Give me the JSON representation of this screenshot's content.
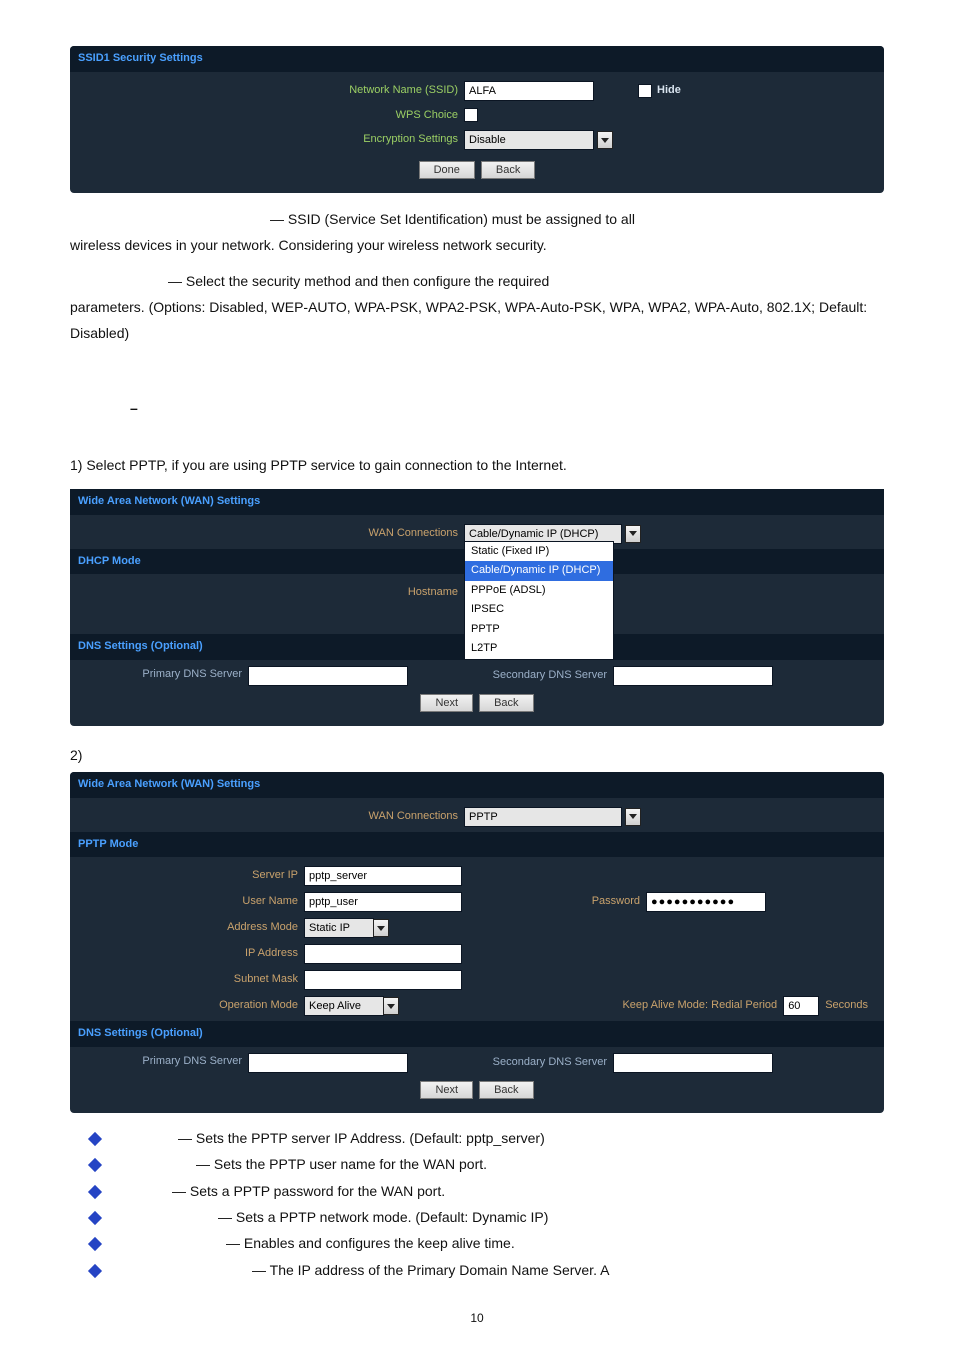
{
  "ssid_panel": {
    "title": "SSID1 Security Settings",
    "rows": {
      "network_name_label": "Network Name (SSID)",
      "network_name_value": "ALFA",
      "hide_label": "Hide",
      "wps_label": "WPS Choice",
      "encryption_label": "Encryption Settings",
      "encryption_value": "Disable"
    },
    "buttons": {
      "done": "Done",
      "back": "Back"
    }
  },
  "para1_a": "— SSID (Service Set Identification) must be assigned to all",
  "para1_b": "wireless devices in your network. Considering your wireless network security.",
  "para2_a": "— Select the security method and then configure the required",
  "para2_b": "parameters. (Options: Disabled, WEP-AUTO, WPA-PSK, WPA2-PSK, WPA-Auto-PSK, WPA, WPA2, WPA-Auto, 802.1X; Default: Disabled)",
  "dash": "–",
  "step1": "1)  Select PPTP, if you are using PPTP service to gain connection to the Internet.",
  "wan_panel": {
    "title": "Wide Area Network (WAN) Settings",
    "wan_conn_label": "WAN Connections",
    "wan_conn_value": "Cable/Dynamic IP (DHCP)",
    "dhcp_mode": "DHCP Mode",
    "hostname_label": "Hostname",
    "dns_header": "DNS Settings (Optional)",
    "primary_dns_label": "Primary DNS Server",
    "secondary_dns_label": "Secondary DNS Server",
    "options": [
      "Static (Fixed IP)",
      "Cable/Dynamic IP (DHCP)",
      "PPPoE (ADSL)",
      "IPSEC",
      "PPTP",
      "L2TP"
    ],
    "buttons": {
      "next": "Next",
      "back": "Back"
    }
  },
  "step2": "2)",
  "pptp_panel": {
    "title": "Wide Area Network (WAN) Settings",
    "wan_conn_label": "WAN Connections",
    "wan_conn_value": "PPTP",
    "mode_header": "PPTP Mode",
    "server_ip_label": "Server IP",
    "server_ip_value": "pptp_server",
    "user_name_label": "User Name",
    "user_name_value": "pptp_user",
    "password_label": "Password",
    "password_value": "●●●●●●●●●●●",
    "address_mode_label": "Address Mode",
    "address_mode_value": "Static IP",
    "ip_address_label": "IP Address",
    "subnet_mask_label": "Subnet Mask",
    "operation_mode_label": "Operation Mode",
    "operation_mode_value": "Keep Alive",
    "keep_alive_label": "Keep Alive Mode: Redial Period",
    "keep_alive_value": "60",
    "keep_alive_unit": "Seconds",
    "dns_header": "DNS Settings (Optional)",
    "primary_dns_label": "Primary DNS Server",
    "secondary_dns_label": "Secondary DNS Server",
    "buttons": {
      "next": "Next",
      "back": "Back"
    }
  },
  "bullets": [
    "— Sets the PPTP server IP Address. (Default: pptp_server)",
    "— Sets the PPTP user name for the WAN port.",
    "— Sets a PPTP password for the WAN port.",
    "— Sets a PPTP network mode. (Default: Dynamic IP)",
    "— Enables and configures the keep alive time.",
    "— The IP address of the Primary Domain Name Server. A"
  ],
  "bullet_indents": [
    60,
    78,
    54,
    100,
    108,
    134
  ],
  "page_number": "10"
}
